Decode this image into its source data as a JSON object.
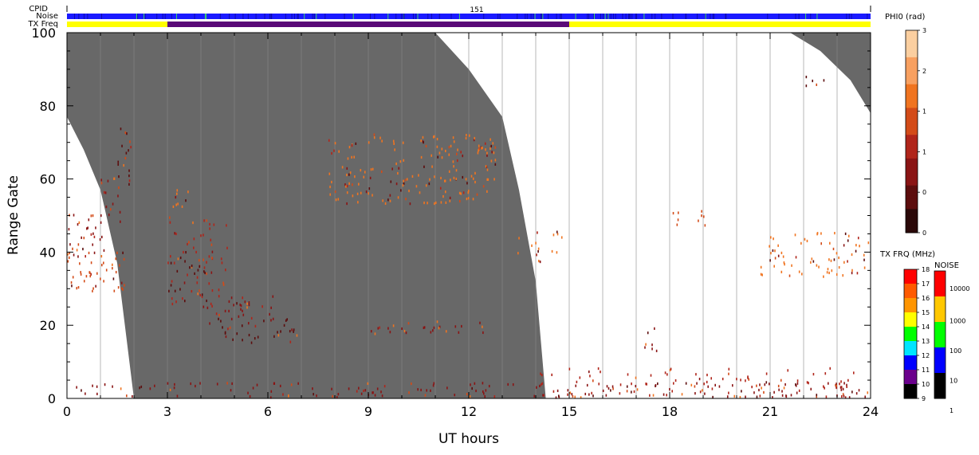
{
  "chart_data": {
    "type": "heatmap",
    "title": "",
    "xlabel": "UT hours",
    "ylabel": "Range Gate",
    "xlim": [
      0,
      24
    ],
    "ylim": [
      0,
      100
    ],
    "x_ticks": [
      0,
      3,
      6,
      9,
      12,
      15,
      18,
      21,
      24
    ],
    "y_ticks": [
      0,
      20,
      40,
      60,
      80,
      100
    ],
    "grid": "vertical lines every hour",
    "header_rows": {
      "cpid_label": "CPID",
      "cpid_value": "151",
      "noise_label": "Noise",
      "txfreq_label": "TX Freq"
    },
    "ground_scatter_color": "#686868",
    "ground_scatter_boundary": {
      "description": "shaded region between lower-left and right curves",
      "left_edge": [
        [
          0,
          77
        ],
        [
          0.5,
          68
        ],
        [
          1.0,
          57
        ],
        [
          1.5,
          37
        ],
        [
          2.0,
          0
        ]
      ],
      "right_edge": [
        [
          11.0,
          100
        ],
        [
          12.0,
          90
        ],
        [
          13.0,
          77
        ],
        [
          13.5,
          57
        ],
        [
          14.0,
          32
        ],
        [
          14.3,
          0
        ]
      ],
      "top_right_cap": [
        [
          21.6,
          100
        ],
        [
          22.5,
          95
        ],
        [
          23.4,
          87
        ],
        [
          24.0,
          78
        ]
      ]
    },
    "phi0_colorbar": {
      "title": "PHI0 (rad)",
      "tick_labels": [
        "3",
        "2",
        "1",
        "1",
        "0",
        "0"
      ],
      "colors": [
        "#2a0808",
        "#5c0d0d",
        "#8a1414",
        "#b0251a",
        "#d34b18",
        "#f07420",
        "#f8a060",
        "#fbcfa0"
      ]
    },
    "txfreq_colorbar": {
      "title": "TX FRQ (MHz)",
      "tick_labels": [
        "18",
        "17",
        "16",
        "15",
        "14",
        "13",
        "12",
        "11",
        "10",
        "9"
      ],
      "colors": [
        "#ff0000",
        "#ff5a00",
        "#ff9500",
        "#ffff00",
        "#00ff00",
        "#00e5ff",
        "#0000ff",
        "#6a008c",
        "#000000"
      ]
    },
    "noise_colorbar": {
      "title": "NOISE",
      "tick_labels": [
        "10000",
        "1000",
        "100",
        "10",
        "1"
      ],
      "colors": [
        "#ff0000",
        "#ffc800",
        "#00ff00",
        "#0000ff",
        "#000000"
      ]
    },
    "scatter_regions": [
      {
        "x": [
          0.0,
          1.2
        ],
        "y": [
          38,
          50
        ],
        "color": "#8a1414",
        "density": 0.55
      },
      {
        "x": [
          0.0,
          1.8
        ],
        "y": [
          29,
          40
        ],
        "color": "#d34b18",
        "density": 0.55
      },
      {
        "x": [
          1.5,
          1.9
        ],
        "y": [
          58,
          76
        ],
        "color": "#5c0d0d",
        "density": 0.6
      },
      {
        "x": [
          1.0,
          1.8
        ],
        "y": [
          48,
          60
        ],
        "color": "#8a1414",
        "density": 0.4
      },
      {
        "x": [
          3.0,
          4.8
        ],
        "y": [
          25,
          50
        ],
        "color": "#b0251a",
        "density": 0.35
      },
      {
        "x": [
          3.0,
          3.9
        ],
        "y": [
          52,
          57
        ],
        "color": "#f07420",
        "density": 0.5
      },
      {
        "x": [
          3.0,
          4.2
        ],
        "y": [
          28,
          38
        ],
        "color": "#5c0d0d",
        "density": 0.4
      },
      {
        "x": [
          4.0,
          6.2
        ],
        "y": [
          20,
          28
        ],
        "color": "#8a1414",
        "density": 0.45
      },
      {
        "x": [
          4.5,
          7.0
        ],
        "y": [
          15,
          22
        ],
        "color": "#5c0d0d",
        "density": 0.45
      },
      {
        "x": [
          7.8,
          12.8
        ],
        "y": [
          53,
          72
        ],
        "color": "#f07420",
        "density": 0.5
      },
      {
        "x": [
          9.0,
          12.6
        ],
        "y": [
          17,
          21
        ],
        "color": "#8a1414",
        "density": 0.45
      },
      {
        "x": [
          13.3,
          14.8
        ],
        "y": [
          37,
          46
        ],
        "color": "#f07420",
        "density": 0.3
      },
      {
        "x": [
          17.2,
          17.6
        ],
        "y": [
          11,
          19
        ],
        "color": "#8a1414",
        "density": 0.55
      },
      {
        "x": [
          18.0,
          19.1
        ],
        "y": [
          47,
          51
        ],
        "color": "#d34b18",
        "density": 0.5
      },
      {
        "x": [
          20.7,
          24.0
        ],
        "y": [
          33,
          45
        ],
        "color": "#f07420",
        "density": 0.45
      },
      {
        "x": [
          0.0,
          24.0
        ],
        "y": [
          0,
          4
        ],
        "color": "#8a1414",
        "density": 0.45
      },
      {
        "x": [
          14.0,
          24.0
        ],
        "y": [
          0,
          8
        ],
        "color": "#b0251a",
        "density": 0.3
      },
      {
        "x": [
          21.5,
          22.6
        ],
        "y": [
          85,
          88
        ],
        "color": "#5c0d0d",
        "density": 0.4
      }
    ]
  }
}
